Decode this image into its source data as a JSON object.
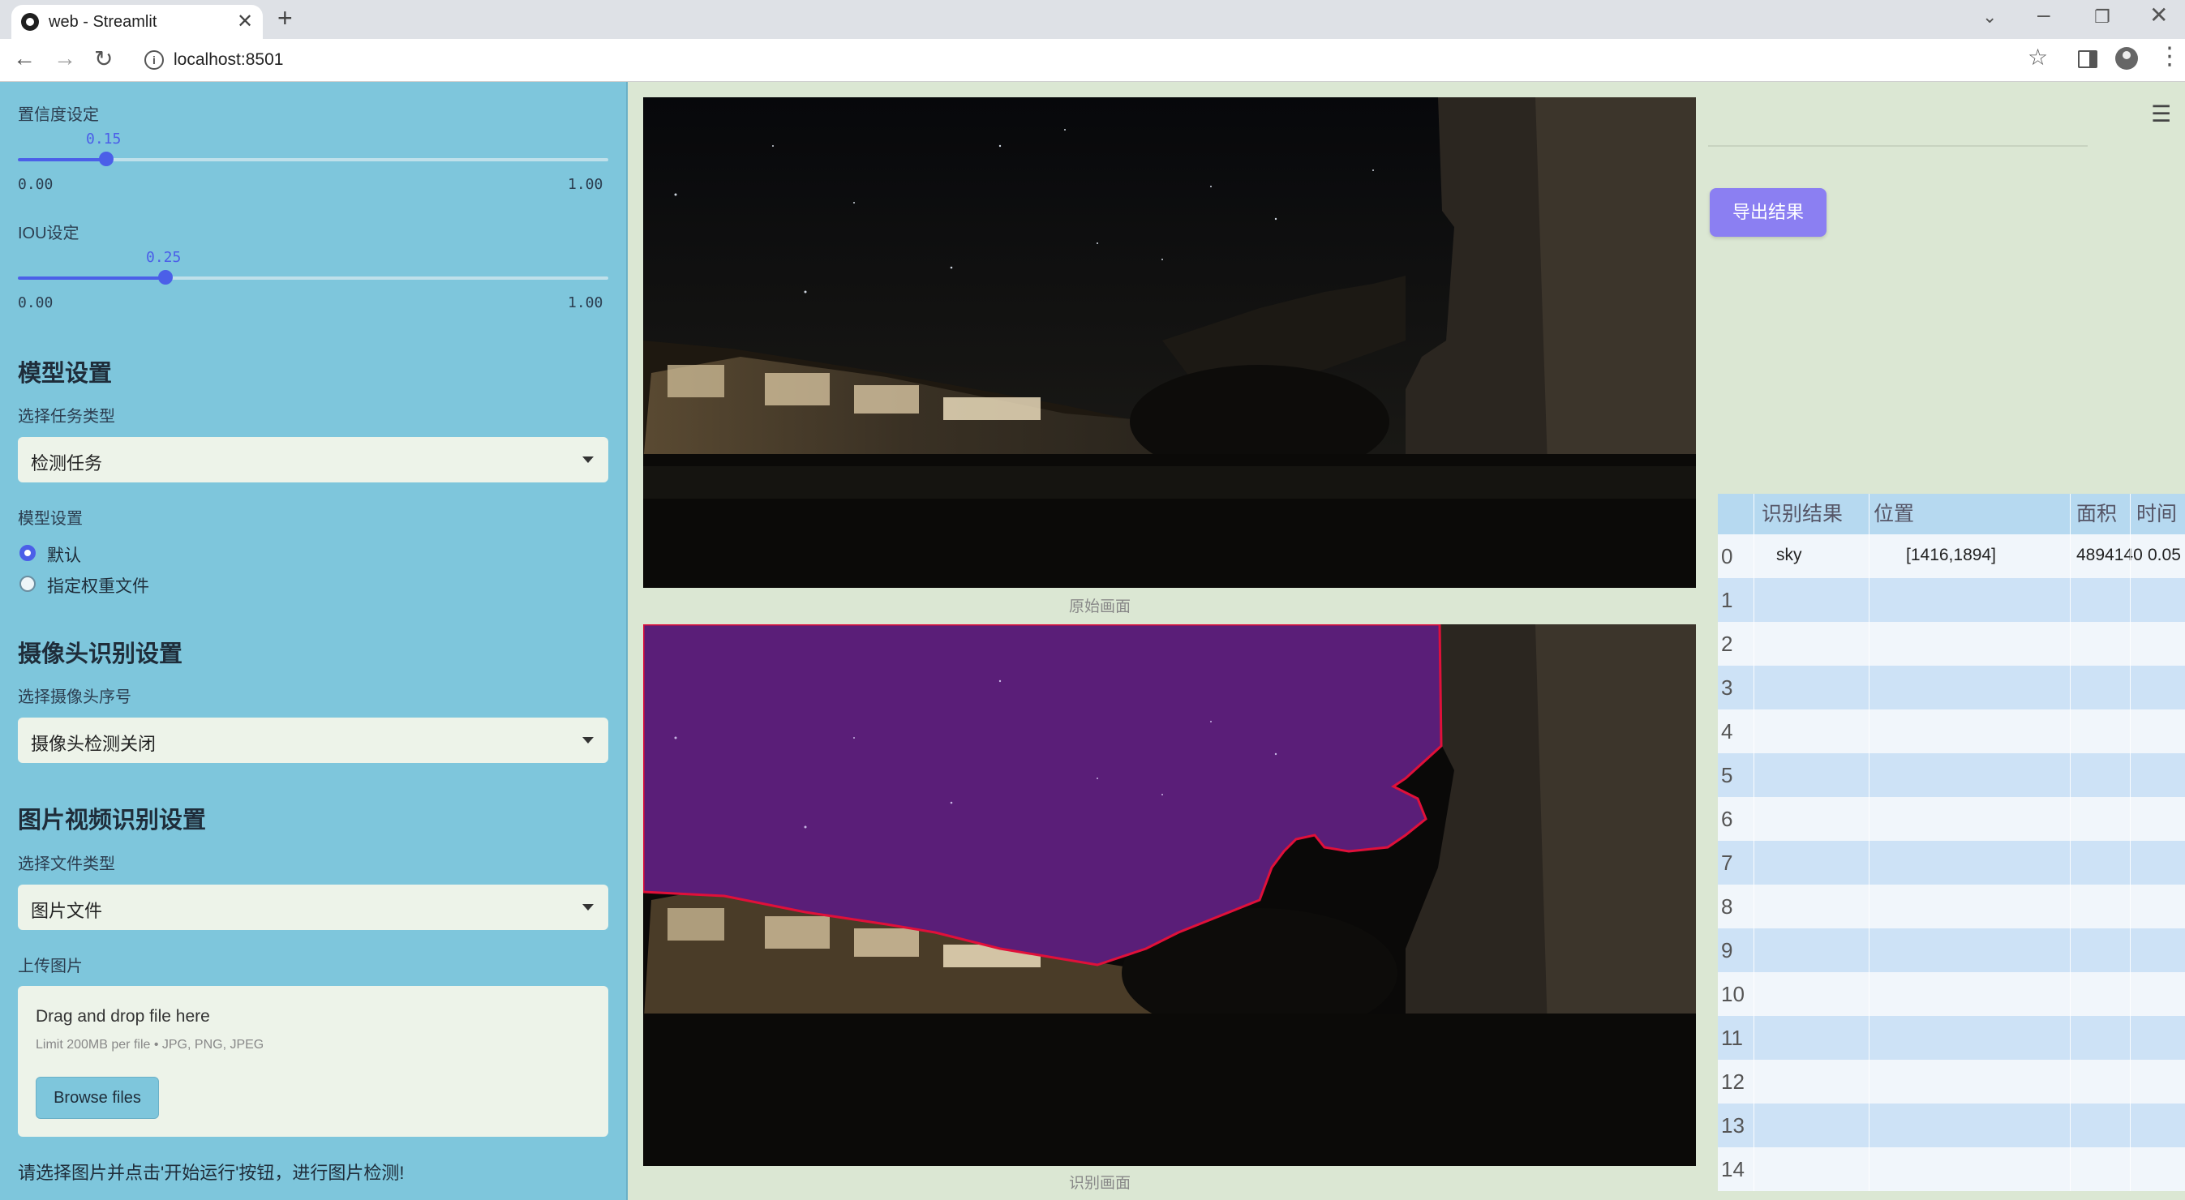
{
  "browser": {
    "tab_title": "web - Streamlit",
    "close_glyph": "✕",
    "new_tab_glyph": "+",
    "url": "localhost:8501",
    "icons": [
      "streamlit-favicon",
      "back-icon",
      "forward-icon",
      "reload-icon",
      "info-icon",
      "bookmark-star-icon",
      "side-panel-icon",
      "profile-icon",
      "menu-dots-icon",
      "tab-search-icon"
    ]
  },
  "sidebar": {
    "confidence": {
      "label": "置信度设定",
      "value": "0.15",
      "min": "0.00",
      "max": "1.00",
      "fraction": 0.15
    },
    "iou": {
      "label": "IOU设定",
      "value": "0.25",
      "min": "0.00",
      "max": "1.00",
      "fraction": 0.25
    },
    "model_settings": {
      "header": "模型设置",
      "task_label": "选择任务类型",
      "task_value": "检测任务",
      "model_label": "模型设置",
      "options": [
        {
          "label": "默认",
          "selected": true
        },
        {
          "label": "指定权重文件",
          "selected": false
        }
      ]
    },
    "camera": {
      "header": "摄像头识别设置",
      "label": "选择摄像头序号",
      "value": "摄像头检测关闭"
    },
    "media": {
      "header": "图片视频识别设置",
      "type_label": "选择文件类型",
      "type_value": "图片文件",
      "upload_label": "上传图片",
      "drop_title": "Drag and drop file here",
      "drop_limit": "Limit 200MB per file • JPG, PNG, JPEG",
      "browse_label": "Browse files"
    },
    "hint": "请选择图片并点击'开始运行'按钮，进行图片检测!"
  },
  "main": {
    "original_caption": "原始画面",
    "detected_caption": "识别画面",
    "export_label": "导出结果",
    "menu_icon": "hamburger-menu-icon"
  },
  "table": {
    "headers": [
      "识别结果",
      "位置",
      "面积",
      "时间"
    ],
    "rows": [
      {
        "index": "0",
        "result": "sky",
        "position": "[1416,1894]",
        "area": "4894140",
        "time": "0.05"
      },
      {
        "index": "1",
        "result": "",
        "position": "",
        "area": "",
        "time": ""
      },
      {
        "index": "2",
        "result": "",
        "position": "",
        "area": "",
        "time": ""
      },
      {
        "index": "3",
        "result": "",
        "position": "",
        "area": "",
        "time": ""
      },
      {
        "index": "4",
        "result": "",
        "position": "",
        "area": "",
        "time": ""
      },
      {
        "index": "5",
        "result": "",
        "position": "",
        "area": "",
        "time": ""
      },
      {
        "index": "6",
        "result": "",
        "position": "",
        "area": "",
        "time": ""
      },
      {
        "index": "7",
        "result": "",
        "position": "",
        "area": "",
        "time": ""
      },
      {
        "index": "8",
        "result": "",
        "position": "",
        "area": "",
        "time": ""
      },
      {
        "index": "9",
        "result": "",
        "position": "",
        "area": "",
        "time": ""
      },
      {
        "index": "10",
        "result": "",
        "position": "",
        "area": "",
        "time": ""
      },
      {
        "index": "11",
        "result": "",
        "position": "",
        "area": "",
        "time": ""
      },
      {
        "index": "12",
        "result": "",
        "position": "",
        "area": "",
        "time": ""
      },
      {
        "index": "13",
        "result": "",
        "position": "",
        "area": "",
        "time": ""
      },
      {
        "index": "14",
        "result": "",
        "position": "",
        "area": "",
        "time": ""
      }
    ]
  },
  "colors": {
    "sidebar_bg": "#7ec6dc",
    "main_bg": "#dbe7d3",
    "accent": "#4b5fe8",
    "export_button": "#8b7ff2",
    "sky_mask": "#5a1e78",
    "mask_outline": "#e0103a"
  }
}
